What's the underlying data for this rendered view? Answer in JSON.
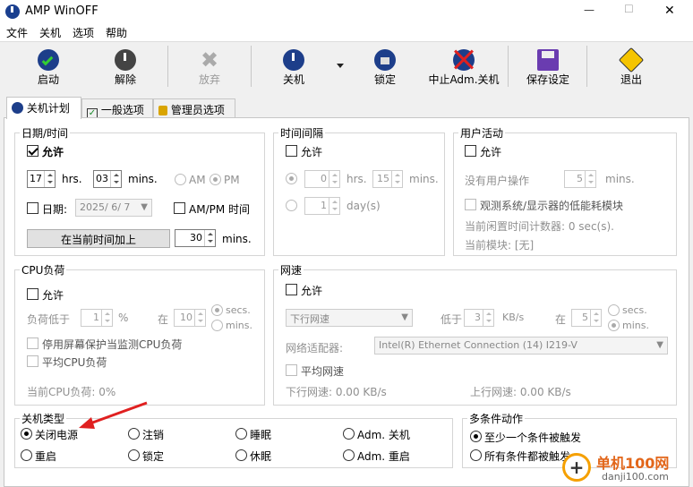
{
  "window": {
    "title": "AMP WinOFF",
    "min": "—",
    "max": "☐",
    "close": "✕"
  },
  "menu": [
    "文件",
    "关机",
    "选项",
    "帮助"
  ],
  "toolbar": {
    "start": "启动",
    "release": "解除",
    "discard": "放弃",
    "shutdown": "关机",
    "lock": "锁定",
    "abort_adm": "中止Adm.关机",
    "save": "保存设定",
    "exit": "退出"
  },
  "tabs": {
    "schedule": "关机计划",
    "general": "一般选项",
    "admin": "管理员选项"
  },
  "datetime": {
    "legend": "日期/时间",
    "allow": "允许",
    "hours": "17",
    "hrs": "hrs.",
    "mins": "03",
    "mins_unit": "mins.",
    "am": "AM",
    "pm": "PM",
    "date_label": "日期:",
    "date_value": "2025/ 6/ 7",
    "ampm_time": "AM/PM 时间",
    "add_button": "在当前时间加上",
    "add_value": "30",
    "add_unit": "mins."
  },
  "interval": {
    "legend": "时间间隔",
    "allow": "允许",
    "hours": "0",
    "hrs": "hrs.",
    "mins": "15",
    "mins_unit": "mins.",
    "days": "1",
    "days_unit": "day(s)"
  },
  "user_activity": {
    "legend": "用户活动",
    "allow": "允许",
    "no_op": "没有用户操作",
    "no_op_value": "5",
    "mins_unit": "mins.",
    "observe": "观测系统/显示器的低能耗模块",
    "idle_counter": "当前闲置时间计数器: 0 sec(s).",
    "current_module": "当前模块: [无]"
  },
  "cpu": {
    "legend": "CPU负荷",
    "allow": "允许",
    "below": "负荷低于",
    "below_value": "1",
    "percent": "%",
    "at": "在",
    "at_value": "10",
    "secs": "secs.",
    "mins": "mins.",
    "screensaver": "停用屏幕保护当监测CPU负荷",
    "average": "平均CPU负荷",
    "current": "当前CPU负荷: 0%"
  },
  "network": {
    "legend": "网速",
    "allow": "允许",
    "direction": "下行网速",
    "below": "低于",
    "below_value": "3",
    "unit": "KB/s",
    "at": "在",
    "at_value": "5",
    "secs": "secs.",
    "mins": "mins.",
    "adapter_label": "网络适配器:",
    "adapter_value": "Intel(R) Ethernet Connection (14) I219-V",
    "average": "平均网速",
    "down": "下行网速: 0.00 KB/s",
    "up": "上行网速: 0.00 KB/s"
  },
  "shutdown_type": {
    "legend": "关机类型",
    "options": [
      "关闭电源",
      "注销",
      "睡眠",
      "Adm. 关机",
      "重启",
      "锁定",
      "休眠",
      "Adm. 重启"
    ]
  },
  "multi": {
    "legend": "多条件动作",
    "any": "至少一个条件被触发",
    "all": "所有条件都被触发"
  },
  "watermark": {
    "name": "单机100网",
    "url": "danji100.com"
  },
  "colors": {
    "arrow": "#e02020",
    "accent": "#1a56c8"
  }
}
